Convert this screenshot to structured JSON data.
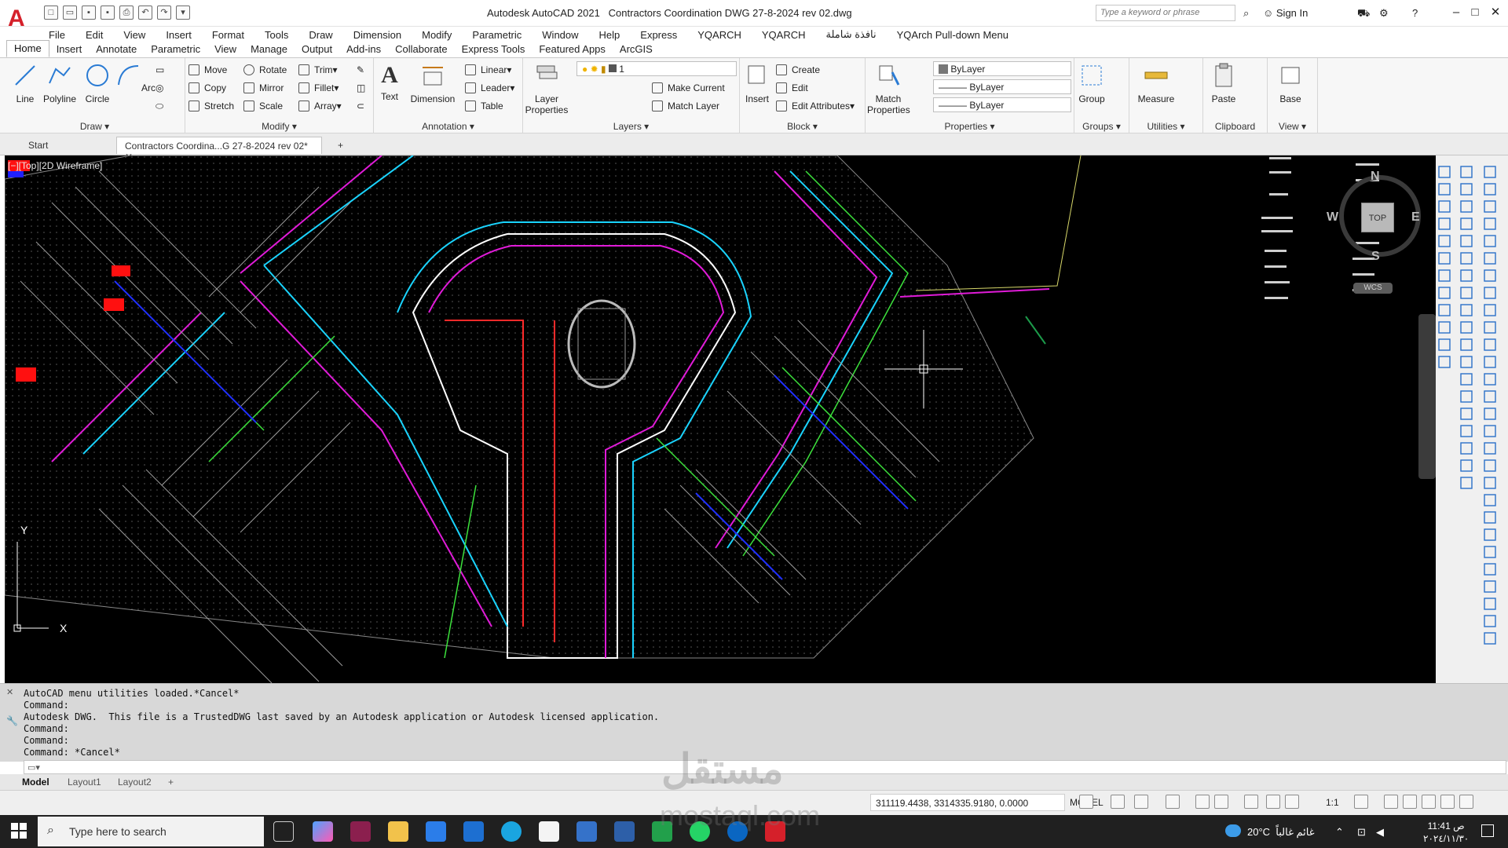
{
  "title_bar": {
    "app_name": "Autodesk AutoCAD 2021",
    "document": "Contractors Coordination DWG 27-8-2024 rev 02.dwg",
    "search_placeholder": "Type a keyword or phrase",
    "sign_in": "Sign In"
  },
  "menu_bar": [
    "File",
    "Edit",
    "View",
    "Insert",
    "Format",
    "Tools",
    "Draw",
    "Dimension",
    "Modify",
    "Parametric",
    "Window",
    "Help",
    "Express",
    "YQARCH",
    "YQARCH",
    "نافذة شاملة",
    "YQArch Pull-down Menu"
  ],
  "ribbon_tabs": [
    "Home",
    "Insert",
    "Annotate",
    "Parametric",
    "View",
    "Manage",
    "Output",
    "Add-ins",
    "Collaborate",
    "Express Tools",
    "Featured Apps",
    "ArcGIS"
  ],
  "ribbon": {
    "draw": {
      "title": "Draw",
      "line": "Line",
      "polyline": "Polyline",
      "circle": "Circle",
      "arc": "Arc"
    },
    "modify": {
      "title": "Modify",
      "move": "Move",
      "rotate": "Rotate",
      "trim": "Trim",
      "copy": "Copy",
      "mirror": "Mirror",
      "fillet": "Fillet",
      "stretch": "Stretch",
      "scale": "Scale",
      "array": "Array"
    },
    "annotation": {
      "title": "Annotation",
      "text": "Text",
      "dimension": "Dimension",
      "linear": "Linear",
      "leader": "Leader",
      "table": "Table"
    },
    "layers": {
      "title": "Layers",
      "layer_properties": "Layer Properties",
      "current_layer": "1",
      "make_current": "Make Current",
      "match_layer": "Match Layer"
    },
    "block": {
      "title": "Block",
      "insert": "Insert",
      "create": "Create",
      "edit": "Edit",
      "edit_attributes": "Edit Attributes"
    },
    "properties": {
      "title": "Properties",
      "match_properties": "Match Properties",
      "color": "ByLayer",
      "linetype": "ByLayer",
      "lineweight": "ByLayer"
    },
    "groups": {
      "title": "Groups",
      "group": "Group"
    },
    "utilities": {
      "title": "Utilities",
      "measure": "Measure"
    },
    "clipboard": {
      "title": "Clipboard",
      "paste": "Paste"
    },
    "view": {
      "title": "View",
      "base": "Base"
    }
  },
  "doc_tabs": {
    "start": "Start",
    "active": "Contractors Coordina...G 27-8-2024 rev 02*"
  },
  "viewport_label": "[−][Top][2D Wireframe]",
  "viewcube": {
    "top": "TOP",
    "n": "N",
    "s": "S",
    "e": "E",
    "w": "W",
    "wcs": "WCS"
  },
  "command_history": [
    "AutoCAD menu utilities loaded.*Cancel*",
    "Command:",
    "Autodesk DWG.  This file is a TrustedDWG last saved by an Autodesk application or Autodesk licensed application.",
    "Command:",
    "Command:",
    "Command: *Cancel*"
  ],
  "layout_tabs": [
    "Model",
    "Layout1",
    "Layout2"
  ],
  "status": {
    "coords": "311119.4438, 3314335.9180, 0.0000",
    "space": "MODEL",
    "scale": "1:1"
  },
  "taskbar": {
    "search": "Type here to search",
    "temperature": "20°C",
    "weather": "غائم غالباً",
    "time": "11:41 ص",
    "date": "٢٠٢٤/١١/٣٠"
  },
  "watermark": {
    "brand": "مستقل",
    "url": "mostaql.com"
  }
}
